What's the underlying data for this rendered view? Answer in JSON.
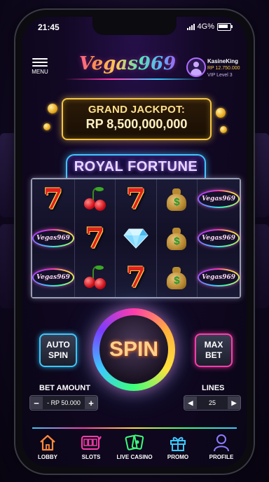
{
  "status": {
    "time": "21:45",
    "network": "4G%"
  },
  "header": {
    "menu_label": "MENU",
    "logo": "Vegas969",
    "user": {
      "name": "KasineKing",
      "balance": "RP 12.750.000",
      "level": "VIP Level 3"
    }
  },
  "jackpot": {
    "label": "GRAND JACKPOT:",
    "amount": "RP 8,500,000,000"
  },
  "game": {
    "title": "ROYAL FORTUNE"
  },
  "reels": {
    "symbols": [
      [
        "seven",
        "cherry",
        "seven",
        "money-bag",
        "vegas969-logo"
      ],
      [
        "vegas969-logo",
        "seven",
        "diamond",
        "money-bag",
        "vegas969-logo"
      ],
      [
        "vegas969-logo",
        "cherry",
        "seven",
        "money-bag",
        "vegas969-logo"
      ]
    ],
    "seven_glyph": "7",
    "logo_text": "Vegas969",
    "dollar_glyph": "$"
  },
  "controls": {
    "auto_spin_line1": "AUTO",
    "auto_spin_line2": "SPIN",
    "spin_label": "SPIN",
    "max_bet_line1": "MAX",
    "max_bet_line2": "BET",
    "bet_amount_label": "BET AMOUNT",
    "bet_value": "RP 50.000",
    "lines_label": "LINES",
    "lines_value": "25",
    "minus": "−",
    "plus": "+",
    "left_arrow": "◀",
    "right_arrow": "▶"
  },
  "nav": {
    "items": [
      {
        "label": "LOBBY",
        "icon": "home-icon",
        "color": "#ff8a3c"
      },
      {
        "label": "SLOTS",
        "icon": "slot-machine-icon",
        "color": "#ff3cac"
      },
      {
        "label": "LIVE CASINO",
        "icon": "cards-icon",
        "color": "#3cff7a"
      },
      {
        "label": "PROMO",
        "icon": "gift-icon",
        "color": "#3cc8ff"
      },
      {
        "label": "PROFILE",
        "icon": "user-icon",
        "color": "#8a7cff"
      }
    ]
  },
  "colors": {
    "accent_pink": "#ff3cac",
    "accent_cyan": "#3cc8ff",
    "gold": "#f5c542"
  }
}
